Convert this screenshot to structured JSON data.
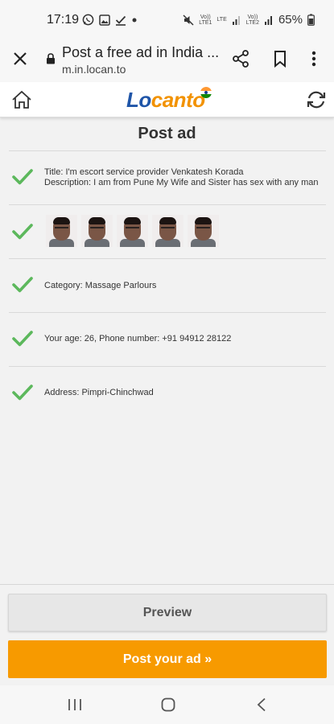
{
  "status_bar": {
    "time": "17:19",
    "battery": "65%",
    "icons": [
      "whatsapp-icon",
      "gallery-icon",
      "check-icon",
      "dot-icon",
      "mute-icon",
      "volte1-icon",
      "lte-icon",
      "signal1-icon",
      "volte2-icon",
      "signal2-icon",
      "battery-icon"
    ],
    "volte1": [
      "Vo))",
      "LTE1"
    ],
    "lte": "LTE",
    "volte2": [
      "Vo))",
      "LTE2"
    ]
  },
  "browser": {
    "title": "Post a free ad in India ...",
    "url": "m.in.locan.to"
  },
  "site": {
    "logo_part1": "Lo",
    "logo_part2": "canto",
    "brand_color": "#1f55a8",
    "accent_color": "#f29200"
  },
  "page": {
    "title": "Post ad",
    "rows": [
      {
        "line1": "Title: I'm escort service provider Venkatesh Korada",
        "line2": "Description: I am from Pune My Wife and Sister has sex with any man"
      },
      {
        "photos_count": 5
      },
      {
        "line1": "Category: Massage Parlours"
      },
      {
        "line1": "Your age: 26, Phone number: +91 94912 28122"
      },
      {
        "line1": "Address: Pimpri-Chinchwad"
      }
    ],
    "check_color": "#5cb85c"
  },
  "buttons": {
    "preview": "Preview",
    "post": "Post your ad »",
    "post_color": "#f79a00"
  }
}
